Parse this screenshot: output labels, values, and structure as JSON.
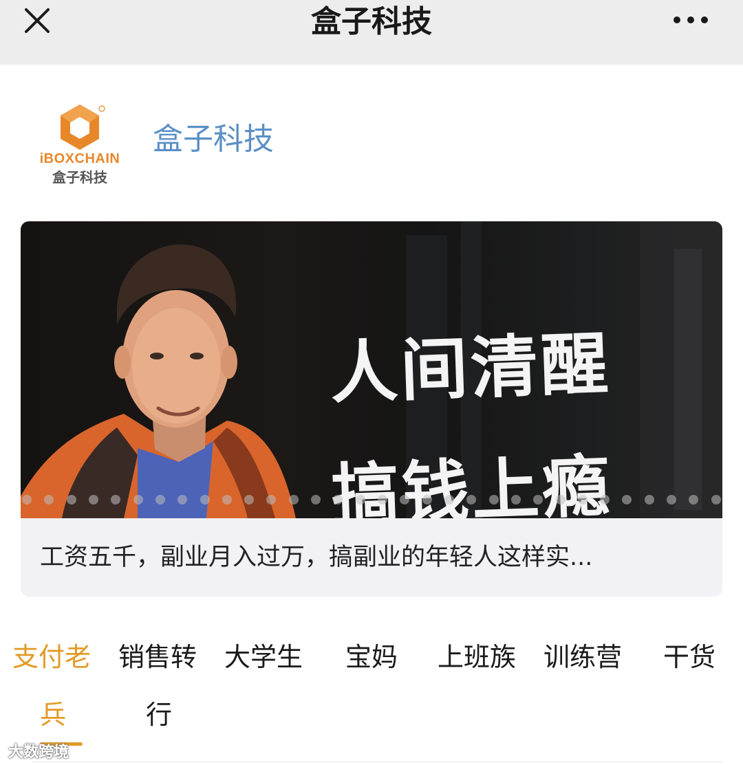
{
  "topbar": {
    "title": "盒子科技",
    "close_icon": "close-icon",
    "more_icon": "more-horizontal-icon",
    "background": "#ededed"
  },
  "account": {
    "name": "盒子科技",
    "name_color": "#5b8fc6",
    "logo": {
      "brand": "iBOXCHAIN",
      "chinese": "盒子科技",
      "accent": "#e8872a"
    }
  },
  "article": {
    "cover_title_line1": "人间清醒",
    "cover_title_line2": "搞钱上瘾",
    "caption": "工资五千，副业月入过万，搞副业的年轻人这样实..."
  },
  "tabs": {
    "accent": "#e39a27",
    "items": [
      {
        "label": "支付老"
      },
      {
        "label": "销售转"
      },
      {
        "label": "大学生"
      },
      {
        "label": "宝妈"
      },
      {
        "label": "上班族"
      },
      {
        "label": "训练营"
      },
      {
        "label": "干货"
      }
    ],
    "overflow": [
      {
        "label": "兵"
      },
      {
        "label": "行"
      }
    ]
  },
  "watermark": "大数跨境"
}
